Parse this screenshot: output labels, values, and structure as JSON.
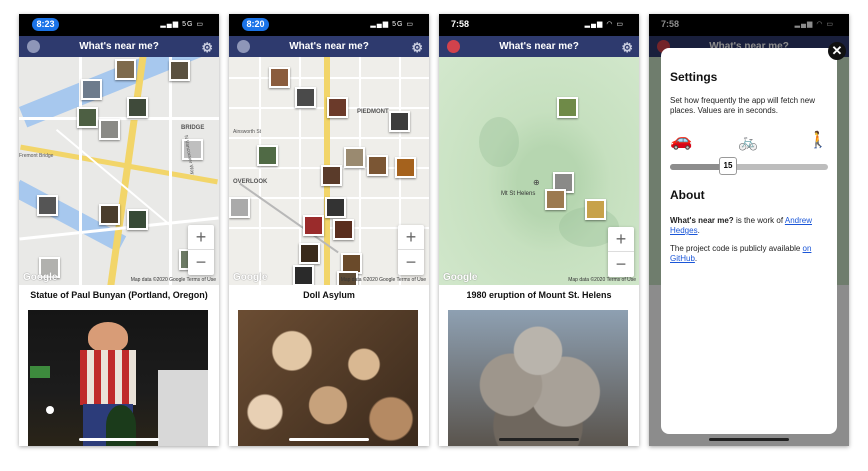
{
  "app": {
    "title": "What's near me?"
  },
  "phones": [
    {
      "time": "8:23",
      "caption": "Statue of Paul Bunyan (Portland, Oregon)",
      "map_attr": "Map data ©2020 Google   Terms of Use",
      "labels": {
        "bridge": "BRIDGE",
        "vancouver": "N Vancouver Way",
        "fremont": "Fremont Bridge"
      }
    },
    {
      "time": "8:20",
      "caption": "Doll Asylum",
      "map_attr": "Map data ©2020 Google   Terms of Use",
      "labels": {
        "piedmont": "PIEDMONT",
        "ainsworth": "Ainsworth St",
        "overlook": "OVERLOOK"
      }
    },
    {
      "time": "7:58",
      "caption": "1980 eruption of Mount St. Helens",
      "map_attr": "Map data ©2020   Terms of Use",
      "labels": {
        "msh": "Mt St Helens"
      }
    },
    {
      "time": "7:58"
    }
  ],
  "map": {
    "zoom_in": "+",
    "zoom_out": "−",
    "google": "Google"
  },
  "settings": {
    "heading": "Settings",
    "description": "Set how frequently the app will fetch new places. Values are in seconds.",
    "slider_value": "15",
    "slider_fraction": 0.35,
    "about_heading": "About",
    "about_bold": "What's near me?",
    "about_text": "is the work of",
    "about_link": "Andrew Hedges",
    "code_text": "The project code is publicly available",
    "code_link": "on GitHub",
    "close": "✕"
  },
  "colors": {
    "titlebar": "#2e3a6e",
    "time_pill": "#1a73e8",
    "link": "#1a56d8"
  }
}
